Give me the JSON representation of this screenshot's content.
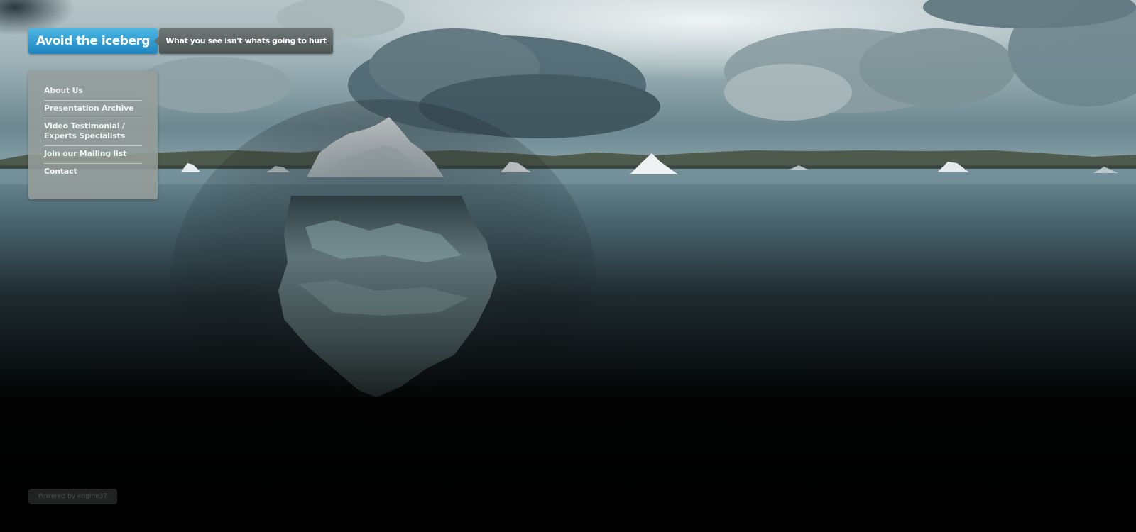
{
  "header": {
    "title": "Avoid the iceberg",
    "tagline": "What you see isn't whats going to hurt"
  },
  "nav": {
    "items": [
      {
        "label": "About Us"
      },
      {
        "label": "Presentation Archive"
      },
      {
        "label": "Video Testimonial / Experts Specialists"
      },
      {
        "label": "Join our Mailing list"
      },
      {
        "label": "Contact"
      }
    ]
  },
  "footer": {
    "powered_by": "Powered by engine37"
  },
  "colors": {
    "title_accent": "#2a9bd3",
    "tagline_bg": "#5a6262",
    "nav_panel_bg": "#969e9b",
    "page_bg": "#000000"
  },
  "icons": {
    "tagline_pointer": "triangle-left-icon"
  }
}
